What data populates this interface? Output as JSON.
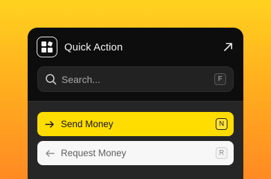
{
  "header": {
    "app_icon": "app-grid-icon",
    "title": "Quick Action",
    "expand_icon": "arrow-up-right-icon"
  },
  "search": {
    "placeholder": "Search...",
    "value": "",
    "shortcut": "F",
    "icon": "search-icon"
  },
  "actions": [
    {
      "label": "Send Money",
      "shortcut": "N",
      "icon": "arrow-right-icon",
      "state": "highlighted"
    },
    {
      "label": "Request Money",
      "shortcut": "R",
      "icon": "arrow-left-icon",
      "state": "default"
    }
  ],
  "colors": {
    "background_top": "#ffd21f",
    "background_bottom": "#ff8a23",
    "panel": "#0d0d0d",
    "list_area": "#262626",
    "highlight": "#ffdd00",
    "secondary_item": "#f7f7f7"
  }
}
